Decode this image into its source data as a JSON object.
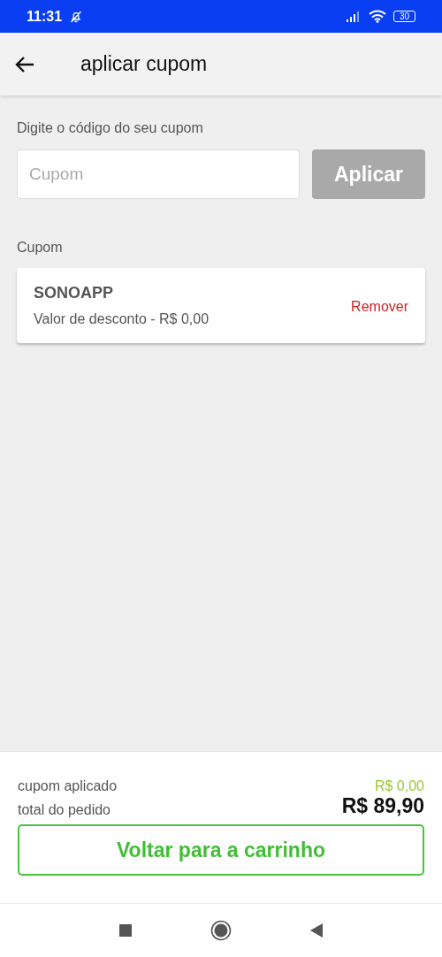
{
  "status_bar": {
    "time": "11:31",
    "battery": "30"
  },
  "header": {
    "title": "aplicar cupom"
  },
  "coupon_entry": {
    "label": "Digite o código do seu cupom",
    "placeholder": "Cupom",
    "apply_button": {
      "label": "Aplicar",
      "disabled": true
    }
  },
  "applied_section": {
    "label": "Cupom",
    "coupons": [
      {
        "code": "SONOAPP",
        "discount": "Valor de desconto - R$ 0,00",
        "remove": "Remover"
      }
    ]
  },
  "summary": {
    "rows": [
      {
        "label": "cupom aplicado",
        "value": "R$ 0,00",
        "kind": "discount"
      },
      {
        "label": "total do pedido",
        "value": "R$ 89,90",
        "kind": "total"
      }
    ],
    "button": "Voltar para a carrinho"
  }
}
